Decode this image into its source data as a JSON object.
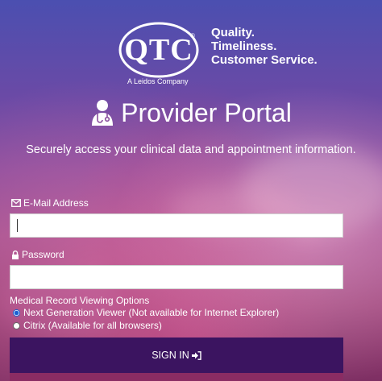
{
  "brand": {
    "logo_text": "QTC",
    "registered_mark": "®",
    "tagline": [
      "Quality.",
      "Timeliness.",
      "Customer Service."
    ],
    "parent_company": "A Leidos Company"
  },
  "header": {
    "title": "Provider Portal",
    "title_icon": "doctor-icon",
    "subtitle": "Securely access your clinical data and appointment information."
  },
  "form": {
    "email_label": "E-Mail Address",
    "email_icon": "envelope-icon",
    "email_value": "",
    "password_label": "Password",
    "password_icon": "lock-icon",
    "password_value": "",
    "viewing_options_title": "Medical Record Viewing Options",
    "viewing_options": [
      {
        "label": "Next Generation Viewer (Not available for Internet Explorer)",
        "checked": true
      },
      {
        "label": "Citrix (Available for all browsers)",
        "checked": false
      }
    ],
    "signin_label": "SIGN IN",
    "signin_icon": "sign-in-icon"
  },
  "colors": {
    "signin_button": "#3b1460",
    "radio_selected": "#1a5fd1"
  }
}
